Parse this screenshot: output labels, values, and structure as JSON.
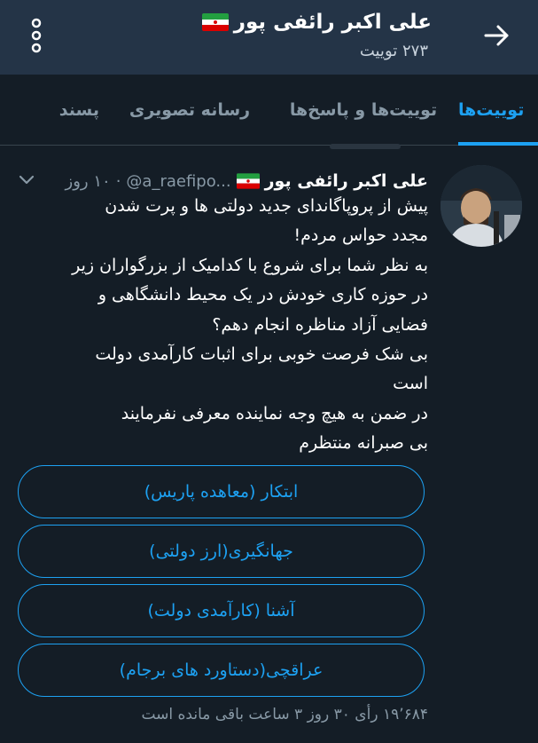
{
  "header": {
    "title": "علی اکبر رائفی پور",
    "tweet_count": "۲۷۳ توییت",
    "back_icon": "arrow-right-icon",
    "menu_icon": "more-vertical-icon",
    "flag_icon": "iran-flag-icon"
  },
  "tabs": [
    {
      "label": "توییت‌ها",
      "active": true
    },
    {
      "label": "توییت‌ها و پاسخ‌ها",
      "active": false
    },
    {
      "label": "رسانه تصویری",
      "active": false
    },
    {
      "label": "پسند",
      "active": false
    }
  ],
  "tweet": {
    "name": "علی اکبر رائفی پور",
    "handle": "@a_raefipo...",
    "time": "۱۰ روز",
    "separator": "·",
    "lines": [
      "پیش از پروپاگاندای جدید دولتی ها و پرت شدن",
      "مجدد حواس مردم!",
      "به نظر شما برای شروع با کدامیک از بزرگواران زیر",
      "در حوزه کاری خودش در یک محیط دانشگاهی و",
      "فضایی آزاد مناظره انجام دهم؟",
      "بی شک فرصت خوبی برای اثبات کارآمدی دولت",
      "است",
      "در ضمن به هیچ وجه نماینده معرفی نفرمایند",
      "بی صبرانه منتظرم"
    ]
  },
  "poll": {
    "options": [
      "ابتکار (معاهده پاریس)",
      "جهانگیری(ارز دولتی)",
      "آشنا (کارآمدی دولت)",
      "عراقچی(دستاورد های برجام)"
    ],
    "meta": "۱۹٬۶۸۴ رأی ۳۰ روز ۳ ساعت باقی مانده است"
  },
  "colors": {
    "background": "#141d26",
    "header_bg": "#243447",
    "accent": "#1da1f2",
    "secondary_text": "#8899a6"
  }
}
